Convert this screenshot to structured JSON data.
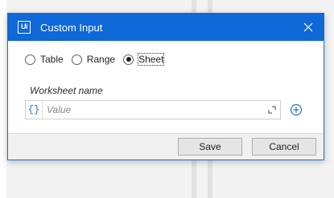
{
  "dialog": {
    "title": "Custom Input",
    "app_icon_text": "Ui",
    "close_icon": "close-icon"
  },
  "source_options": [
    {
      "label": "Table",
      "checked": false
    },
    {
      "label": "Range",
      "checked": false
    },
    {
      "label": "Sheet",
      "checked": true
    }
  ],
  "field": {
    "label": "Worksheet name",
    "value": "",
    "placeholder": "Value",
    "expression_icon": "{}",
    "expand_icon": "expand-icon",
    "add_icon": "plus-circle-icon"
  },
  "buttons": {
    "save_label": "Save",
    "cancel_label": "Cancel"
  },
  "colors": {
    "titlebar": "#0e68d8",
    "accent": "#2a73c6"
  }
}
